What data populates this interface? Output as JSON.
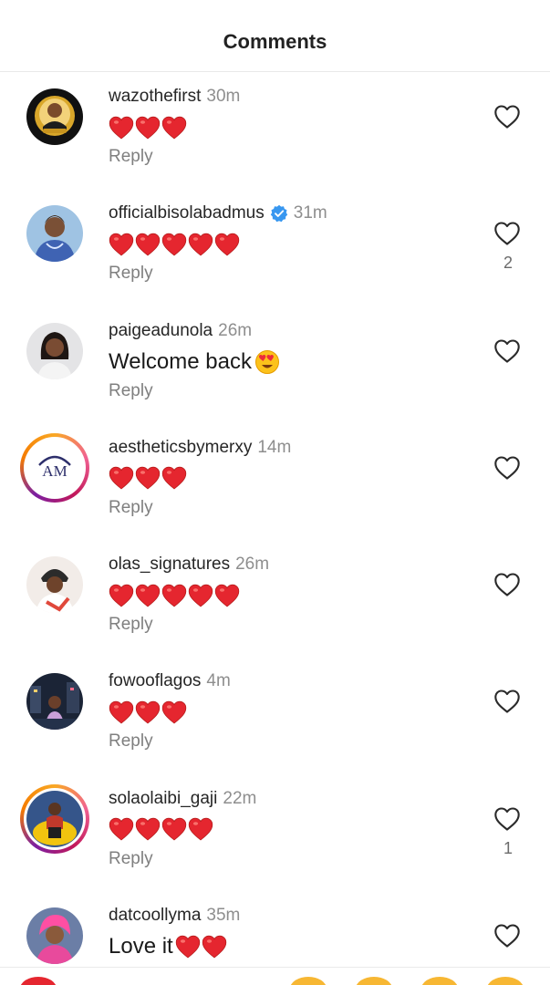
{
  "header": {
    "title": "Comments"
  },
  "colors": {
    "heart_red": "#e5262f",
    "verified_blue": "#3897f0",
    "muted": "#8e8e8e"
  },
  "comments": [
    {
      "username": "wazothefirst",
      "verified": false,
      "time": "30m",
      "text": "",
      "hearts": 3,
      "emoji": "",
      "reply_label": "Reply",
      "likes": "",
      "story_ring": false,
      "avatar": "man-gold-frame"
    },
    {
      "username": "officialbisolabadmus",
      "verified": true,
      "time": "31m",
      "text": "",
      "hearts": 5,
      "emoji": "",
      "reply_label": "Reply",
      "likes": "2",
      "story_ring": false,
      "avatar": "woman-blue"
    },
    {
      "username": "paigeadunola",
      "verified": false,
      "time": "26m",
      "text": "Welcome back",
      "hearts": 0,
      "emoji": "heart-eyes",
      "reply_label": "Reply",
      "likes": "",
      "story_ring": false,
      "avatar": "woman-grey"
    },
    {
      "username": "aestheticsbymerxy",
      "verified": false,
      "time": "14m",
      "text": "",
      "hearts": 3,
      "emoji": "",
      "reply_label": "Reply",
      "likes": "",
      "story_ring": true,
      "avatar": "am-logo",
      "avatar_text": "AM"
    },
    {
      "username": "olas_signatures",
      "verified": false,
      "time": "26m",
      "text": "",
      "hearts": 5,
      "emoji": "",
      "reply_label": "Reply",
      "likes": "",
      "story_ring": false,
      "avatar": "woman-headwrap"
    },
    {
      "username": "fowooflagos",
      "verified": false,
      "time": "4m",
      "text": "",
      "hearts": 3,
      "emoji": "",
      "reply_label": "Reply",
      "likes": "",
      "story_ring": false,
      "avatar": "city-night"
    },
    {
      "username": "solaolaibi_gaji",
      "verified": false,
      "time": "22m",
      "text": "",
      "hearts": 4,
      "emoji": "",
      "reply_label": "Reply",
      "likes": "1",
      "story_ring": true,
      "avatar": "man-yellow-chair"
    },
    {
      "username": "datcoollyma",
      "verified": false,
      "time": "35m",
      "text": "Love it",
      "hearts": 2,
      "emoji": "",
      "reply_label": "",
      "likes": "",
      "story_ring": false,
      "avatar": "woman-pink"
    }
  ]
}
